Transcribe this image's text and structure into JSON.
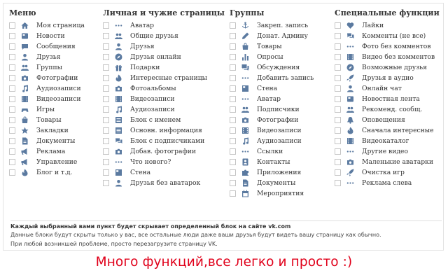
{
  "columns": [
    {
      "title": "Меню",
      "items": [
        {
          "label": "Моя страница",
          "icon": "home-icon"
        },
        {
          "label": "Новости",
          "icon": "news-icon"
        },
        {
          "label": "Сообщения",
          "icon": "message-icon"
        },
        {
          "label": "Друзья",
          "icon": "user-icon"
        },
        {
          "label": "Группы",
          "icon": "group-icon"
        },
        {
          "label": "Фотографии",
          "icon": "camera-icon"
        },
        {
          "label": "Аудиозаписи",
          "icon": "music-icon"
        },
        {
          "label": "Видеозаписи",
          "icon": "video-icon"
        },
        {
          "label": "Игры",
          "icon": "gamepad-icon"
        },
        {
          "label": "Товары",
          "icon": "shopping-bag-icon"
        },
        {
          "label": "Закладки",
          "icon": "star-icon"
        },
        {
          "label": "Документы",
          "icon": "document-icon"
        },
        {
          "label": "Реклама",
          "icon": "megaphone-icon"
        },
        {
          "label": "Управление",
          "icon": "megaphone-icon"
        },
        {
          "label": "Блог и т.д.",
          "icon": "flame-icon"
        }
      ]
    },
    {
      "title": "Личная и чужие страницы",
      "items": [
        {
          "label": "Аватар",
          "icon": "dots-icon"
        },
        {
          "label": "Общие друзья",
          "icon": "group-icon"
        },
        {
          "label": "Друзья",
          "icon": "user-icon"
        },
        {
          "label": "Друзья онлайн",
          "icon": "compass-icon"
        },
        {
          "label": "Подарки",
          "icon": "gift-icon"
        },
        {
          "label": "Интересные страницы",
          "icon": "flame-icon"
        },
        {
          "label": "Фотоальбомы",
          "icon": "camera-icon"
        },
        {
          "label": "Видеозаписи",
          "icon": "video-icon"
        },
        {
          "label": "Аудиозаписи",
          "icon": "music-icon"
        },
        {
          "label": "Блок с именем",
          "icon": "list-icon"
        },
        {
          "label": "Основн. информация",
          "icon": "list-icon"
        },
        {
          "label": "Блок с подписчиками",
          "icon": "chat-icon"
        },
        {
          "label": "Добав. фотографии",
          "icon": "camera-icon"
        },
        {
          "label": "Что нового?",
          "icon": "dots-icon"
        },
        {
          "label": "Стена",
          "icon": "wall-icon"
        },
        {
          "label": "Друзья без аватарок",
          "icon": "user-icon"
        }
      ]
    },
    {
      "title": "Группы",
      "items": [
        {
          "label": "Закреп. запись",
          "icon": "anchor-icon"
        },
        {
          "label": "Донат. Админу",
          "icon": "pen-icon"
        },
        {
          "label": "Товары",
          "icon": "shopping-bag-icon"
        },
        {
          "label": "Опросы",
          "icon": "bar-chart-icon"
        },
        {
          "label": "Обсуждения",
          "icon": "discussion-icon"
        },
        {
          "label": "Добавить запись",
          "icon": "dots-icon"
        },
        {
          "label": "Стена",
          "icon": "wall-icon"
        },
        {
          "label": "Аватар",
          "icon": "dots-icon"
        },
        {
          "label": "Подписчики",
          "icon": "group-icon"
        },
        {
          "label": "Фотографии",
          "icon": "camera-icon"
        },
        {
          "label": "Видеозаписи",
          "icon": "video-icon"
        },
        {
          "label": "Аудиозаписи",
          "icon": "music-icon"
        },
        {
          "label": "Ссылки",
          "icon": "dots-icon"
        },
        {
          "label": "Контакты",
          "icon": "contacts-icon"
        },
        {
          "label": "Приложения",
          "icon": "puzzle-icon"
        },
        {
          "label": "Документы",
          "icon": "document-icon"
        },
        {
          "label": "Мероприятия",
          "icon": "calendar-icon"
        }
      ]
    },
    {
      "title": "Специальные функции",
      "items": [
        {
          "label": "Лайки",
          "icon": "heart-icon"
        },
        {
          "label": "Комменты (не все)",
          "icon": "chat-icon"
        },
        {
          "label": "Фото без комментов",
          "icon": "dots-icon"
        },
        {
          "label": "Видео без комментов",
          "icon": "video-icon"
        },
        {
          "label": "Возможные друзья",
          "icon": "compass-icon"
        },
        {
          "label": "Друзья в аудио",
          "icon": "rocket-icon"
        },
        {
          "label": "Онлайн чат",
          "icon": "user-icon"
        },
        {
          "label": "Новостная лента",
          "icon": "news-icon"
        },
        {
          "label": "Рекоменд. сообщ.",
          "icon": "group-icon"
        },
        {
          "label": "Оповещения",
          "icon": "bell-icon"
        },
        {
          "label": "Сначала интересные",
          "icon": "flame-icon"
        },
        {
          "label": "Видеокаталог",
          "icon": "video-icon"
        },
        {
          "label": "Другие видео",
          "icon": "dots-icon"
        },
        {
          "label": "Маленькие аватарки",
          "icon": "camera-icon"
        },
        {
          "label": "Очистка игр",
          "icon": "rocket-icon"
        },
        {
          "label": "Реклама слева",
          "icon": "dots-icon"
        }
      ]
    }
  ],
  "note": {
    "line1": "Каждый выбранный вами пункт будет скрывает определенный блок на сайте vk.com",
    "line2": "Данные блоки будут скрыты только у вас, все остальные люди даже ваши друзья будут видеть вашу страницу как обычно.",
    "line3": "При любой возникшей проблеме, просто перезагрузите страницу VK."
  },
  "promo": "Много функций,все легко и просто :)",
  "colors": {
    "icon": "#5b7aa0",
    "promo": "#e0001a"
  }
}
